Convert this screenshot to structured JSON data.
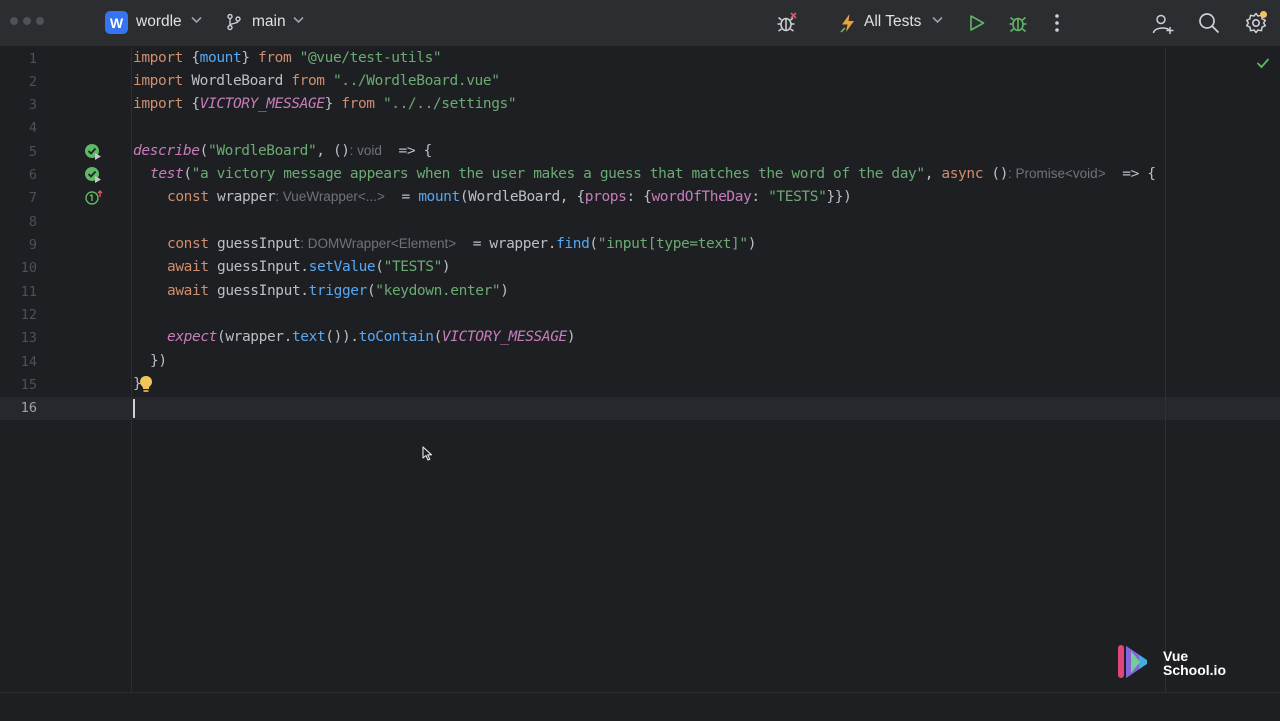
{
  "header": {
    "project_badge": "W",
    "project_name": "wordle",
    "branch": "main",
    "run_config": "All Tests"
  },
  "editor": {
    "line_numbers": [
      "1",
      "2",
      "3",
      "4",
      "5",
      "6",
      "7",
      "8",
      "9",
      "10",
      "11",
      "12",
      "13",
      "14",
      "15",
      "16"
    ],
    "lines": {
      "l1": {
        "a": "import ",
        "b": "{",
        "c": "mount",
        "d": "} ",
        "e": "from ",
        "f": "\"@vue/test-utils\""
      },
      "l2": {
        "a": "import ",
        "b": "WordleBoard ",
        "c": "from ",
        "d": "\"../WordleBoard.vue\""
      },
      "l3": {
        "a": "import ",
        "b": "{",
        "c": "VICTORY_MESSAGE",
        "d": "} ",
        "e": "from ",
        "f": "\"../../settings\""
      },
      "l5": {
        "a": "describe",
        "b": "(",
        "c": "\"WordleBoard\"",
        "d": ", ()",
        "e": ": void",
        "f": "  => {"
      },
      "l6": {
        "a": "test",
        "b": "(",
        "c": "\"a victory message appears when the user makes a guess that matches the word of the day\"",
        "d": ", ",
        "e": "async ",
        "f": "()",
        "g": ": Promise<void>",
        "h": "  => {"
      },
      "l7": {
        "a": "const ",
        "b": "wrapper",
        "c": ": VueWrapper<...>",
        "d": "  = ",
        "e": "mount",
        "f": "(WordleBoard, {",
        "g": "props",
        "h": ": {",
        "i": "wordOfTheDay",
        "j": ": ",
        "k": "\"TESTS\"",
        "l": "}})"
      },
      "l9": {
        "a": "const ",
        "b": "guessInput",
        "c": ": DOMWrapper<Element>",
        "d": "  = wrapper.",
        "e": "find",
        "f": "(",
        "g": "\"input[type=text]\"",
        "h": ")"
      },
      "l10": {
        "a": "await ",
        "b": "guessInput.",
        "c": "setValue",
        "d": "(",
        "e": "\"TESTS\"",
        "f": ")"
      },
      "l11": {
        "a": "await ",
        "b": "guessInput.",
        "c": "trigger",
        "d": "(",
        "e": "\"keydown.enter\"",
        "f": ")"
      },
      "l13": {
        "a": "expect",
        "b": "(wrapper.",
        "c": "text",
        "d": "()).",
        "e": "toContain",
        "f": "(",
        "g": "VICTORY_MESSAGE",
        "h": ")"
      },
      "l14": {
        "a": "})"
      },
      "l15": {
        "a": "}"
      }
    }
  },
  "logo": {
    "line1": "Vue",
    "line2": "School.io"
  },
  "colors": {
    "keyword": "#cf8e6d",
    "string": "#6aab73",
    "function": "#56a8f5",
    "italic": "#c77dbb",
    "accent": "#3574f0"
  }
}
